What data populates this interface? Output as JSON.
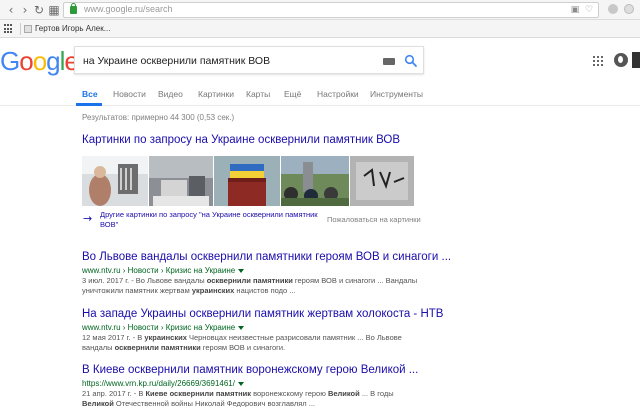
{
  "browser": {
    "url": "www.google.ru/search",
    "bookmark_label": "Гертов Игорь Алек..."
  },
  "logo": {
    "letters": [
      "G",
      "o",
      "o",
      "g",
      "l",
      "e"
    ],
    "colors": [
      "#4285F4",
      "#EA4335",
      "#FBBC05",
      "#4285F4",
      "#34A853",
      "#EA4335"
    ]
  },
  "search": {
    "query": "на Украине осквернили памятник ВОВ"
  },
  "tabs": {
    "all": "Все",
    "news": "Новости",
    "video": "Видео",
    "images": "Картинки",
    "maps": "Карты",
    "more": "Ещё",
    "settings": "Настройки",
    "tools": "Инструменты"
  },
  "stats": "Результатов: примерно 44 300 (0,53 сек.)",
  "images_block": {
    "heading": "Картинки по запросу на Украине осквернили памятник ВОВ",
    "more_link": "Другие картинки по запросу \"на Украине осквернили памятник ВОВ\"",
    "complaint": "Пожаловаться на картинки"
  },
  "results": [
    {
      "title": "Во Львове вандалы осквернили памятники героям ВОВ и синагоги ...",
      "url": "www.ntv.ru › Новости › Кризис на Украине",
      "snippet_date": "3 июл. 2017 г. - ",
      "snippet_html": "Во Львове вандалы <b>осквернили памятники</b> героям ВОВ и синагоги ... Вандалы уничтожили памятник жертвам <b>украинских</b> нацистов подо ..."
    },
    {
      "title": "На западе Украины осквернили памятник жертвам холокоста - НТВ",
      "url": "www.ntv.ru › Новости › Кризис на Украине",
      "snippet_date": "12 мая 2017 г. - ",
      "snippet_html": "В <b>украинских</b> Черновцах неизвестные разрисовали памятник ... Во Львове вандалы <b>осквернили памятники</b> героям ВОВ и синагоги."
    },
    {
      "title": "В Киеве осквернили памятник воронежскому герою Великой ...",
      "url": "https://www.vrn.kp.ru/daily/26669/3691461/",
      "snippet_date": "21 апр. 2017 г. - ",
      "snippet_html": "В <b>Киеве осквернили памятник</b> воронежскому герою <b>Великой</b> ... В годы <b>Великой</b> Отечественной войны Николай Федорович возглавлял ..."
    }
  ]
}
